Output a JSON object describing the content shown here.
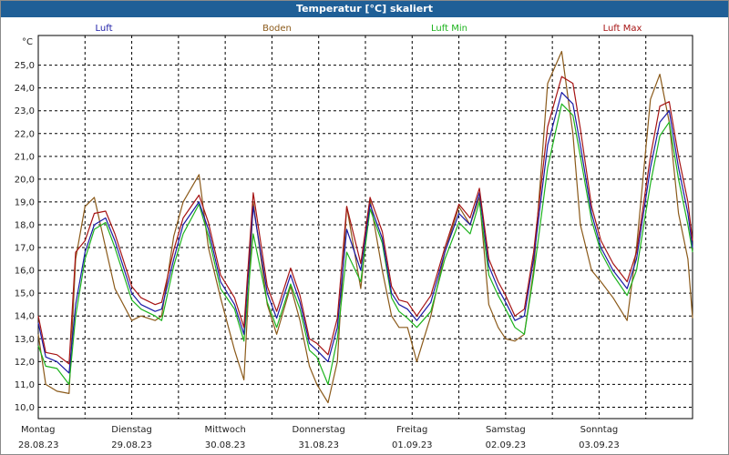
{
  "window": {
    "title": "Temperatur [°C] skaliert"
  },
  "chart_data": {
    "type": "line",
    "title": "Temperatur [°C] skaliert",
    "ylabel": "°C",
    "ylim": [
      9.5,
      26.3
    ],
    "yticks": [
      "10,0",
      "11,0",
      "12,0",
      "13,0",
      "14,0",
      "15,0",
      "16,0",
      "17,0",
      "18,0",
      "19,0",
      "20,0",
      "21,0",
      "22,0",
      "23,0",
      "24,0",
      "25,0"
    ],
    "xlim": [
      0,
      7.0
    ],
    "days": [
      {
        "weekday": "Montag",
        "date": "28.08.23"
      },
      {
        "weekday": "Dienstag",
        "date": "29.08.23"
      },
      {
        "weekday": "Mittwoch",
        "date": "30.08.23"
      },
      {
        "weekday": "Donnerstag",
        "date": "31.08.23"
      },
      {
        "weekday": "Freitag",
        "date": "01.09.23"
      },
      {
        "weekday": "Samstag",
        "date": "02.09.23"
      },
      {
        "weekday": "Sonntag",
        "date": "03.09.23"
      }
    ],
    "grid": true,
    "legend_position": "top",
    "series": [
      {
        "name": "Luft",
        "color": "#1a1aa6",
        "x": [
          0,
          0.08,
          0.2,
          0.33,
          0.4,
          0.5,
          0.6,
          0.72,
          0.82,
          1.0,
          1.1,
          1.25,
          1.32,
          1.45,
          1.55,
          1.72,
          1.82,
          1.95,
          2.1,
          2.2,
          2.3,
          2.45,
          2.55,
          2.7,
          2.8,
          2.9,
          2.98,
          3.1,
          3.2,
          3.3,
          3.45,
          3.55,
          3.68,
          3.78,
          3.86,
          3.95,
          4.05,
          4.2,
          4.35,
          4.5,
          4.62,
          4.72,
          4.82,
          4.92,
          5.0,
          5.1,
          5.2,
          5.3,
          5.45,
          5.6,
          5.72,
          5.8,
          5.92,
          6.02,
          6.15,
          6.3,
          6.4,
          6.55,
          6.65,
          6.75,
          6.85,
          6.95,
          7.0
        ],
        "y": [
          13.7,
          12.2,
          12.0,
          11.5,
          14.5,
          16.8,
          18.0,
          18.3,
          17.3,
          15.0,
          14.5,
          14.2,
          14.3,
          16.5,
          18.0,
          19.0,
          17.8,
          15.5,
          14.5,
          13.2,
          18.8,
          15.0,
          13.9,
          15.8,
          14.6,
          12.8,
          12.5,
          12.0,
          13.5,
          17.8,
          16.0,
          18.9,
          17.4,
          15.0,
          14.5,
          14.3,
          13.8,
          14.6,
          16.8,
          18.5,
          18.0,
          19.4,
          16.2,
          15.2,
          14.6,
          13.8,
          14.0,
          16.5,
          21.5,
          23.8,
          23.3,
          21.5,
          18.5,
          17.0,
          16.0,
          15.2,
          16.5,
          20.5,
          22.5,
          23.0,
          20.5,
          18.5,
          17.0
        ]
      },
      {
        "name": "Boden",
        "color": "#8b5a1a",
        "x": [
          0,
          0.08,
          0.2,
          0.33,
          0.4,
          0.5,
          0.6,
          0.72,
          0.82,
          1.0,
          1.1,
          1.25,
          1.32,
          1.45,
          1.55,
          1.72,
          1.82,
          1.95,
          2.1,
          2.2,
          2.3,
          2.45,
          2.55,
          2.7,
          2.8,
          2.9,
          2.98,
          3.1,
          3.2,
          3.3,
          3.45,
          3.55,
          3.68,
          3.78,
          3.86,
          3.95,
          4.05,
          4.2,
          4.35,
          4.5,
          4.62,
          4.72,
          4.82,
          4.92,
          5.0,
          5.1,
          5.2,
          5.3,
          5.45,
          5.6,
          5.72,
          5.8,
          5.92,
          6.02,
          6.15,
          6.3,
          6.4,
          6.55,
          6.65,
          6.75,
          6.85,
          6.95,
          7.0
        ],
        "y": [
          13.2,
          11.0,
          10.7,
          10.6,
          16.5,
          18.8,
          19.2,
          17.0,
          15.2,
          13.8,
          14.0,
          13.8,
          14.0,
          17.5,
          19.0,
          20.2,
          17.0,
          14.8,
          12.5,
          11.2,
          19.0,
          14.5,
          13.2,
          15.3,
          13.8,
          11.8,
          11.0,
          10.2,
          12.0,
          18.8,
          15.2,
          19.1,
          16.0,
          14.0,
          13.5,
          13.5,
          12.0,
          14.0,
          16.8,
          18.8,
          18.0,
          19.2,
          14.5,
          13.5,
          13.0,
          12.9,
          13.2,
          16.0,
          24.2,
          25.6,
          22.0,
          18.0,
          16.0,
          15.5,
          14.8,
          13.8,
          17.0,
          23.5,
          24.6,
          22.5,
          18.5,
          16.5,
          13.9
        ]
      },
      {
        "name": "Luft Min",
        "color": "#1db31d",
        "x": [
          0,
          0.08,
          0.2,
          0.33,
          0.4,
          0.5,
          0.6,
          0.72,
          0.82,
          1.0,
          1.1,
          1.25,
          1.32,
          1.45,
          1.55,
          1.72,
          1.82,
          1.95,
          2.1,
          2.2,
          2.3,
          2.45,
          2.55,
          2.7,
          2.8,
          2.9,
          2.98,
          3.1,
          3.2,
          3.3,
          3.45,
          3.55,
          3.68,
          3.78,
          3.86,
          3.95,
          4.05,
          4.2,
          4.35,
          4.5,
          4.62,
          4.72,
          4.82,
          4.92,
          5.0,
          5.1,
          5.2,
          5.3,
          5.45,
          5.6,
          5.72,
          5.8,
          5.92,
          6.02,
          6.15,
          6.3,
          6.4,
          6.55,
          6.65,
          6.75,
          6.85,
          6.95,
          7.0
        ],
        "y": [
          12.7,
          11.8,
          11.7,
          11.0,
          14.0,
          16.5,
          17.8,
          18.1,
          17.0,
          14.7,
          14.3,
          14.0,
          13.8,
          16.2,
          17.6,
          18.9,
          17.5,
          15.2,
          14.3,
          12.9,
          17.6,
          14.6,
          13.5,
          15.4,
          14.3,
          12.5,
          12.2,
          11.0,
          13.0,
          16.8,
          15.5,
          18.7,
          17.2,
          14.8,
          14.2,
          13.9,
          13.5,
          14.2,
          16.5,
          18.1,
          17.6,
          19.0,
          15.8,
          14.9,
          14.3,
          13.5,
          13.2,
          15.8,
          20.5,
          23.3,
          22.8,
          21.0,
          18.2,
          16.8,
          15.8,
          14.9,
          16.0,
          19.8,
          21.9,
          22.5,
          20.0,
          18.0,
          16.8
        ]
      },
      {
        "name": "Luft Max",
        "color": "#a61414",
        "x": [
          0,
          0.08,
          0.2,
          0.33,
          0.4,
          0.5,
          0.6,
          0.72,
          0.82,
          1.0,
          1.1,
          1.25,
          1.32,
          1.45,
          1.55,
          1.72,
          1.82,
          1.95,
          2.1,
          2.2,
          2.3,
          2.45,
          2.55,
          2.7,
          2.8,
          2.9,
          2.98,
          3.1,
          3.2,
          3.3,
          3.45,
          3.55,
          3.68,
          3.78,
          3.86,
          3.95,
          4.05,
          4.2,
          4.35,
          4.5,
          4.62,
          4.72,
          4.82,
          4.92,
          5.0,
          5.1,
          5.2,
          5.3,
          5.45,
          5.6,
          5.72,
          5.8,
          5.92,
          6.02,
          6.15,
          6.3,
          6.4,
          6.55,
          6.65,
          6.75,
          6.85,
          6.95,
          7.0
        ],
        "y": [
          14.0,
          12.4,
          12.3,
          11.9,
          16.8,
          17.3,
          18.5,
          18.6,
          17.6,
          15.3,
          14.8,
          14.5,
          14.6,
          16.9,
          18.3,
          19.3,
          18.1,
          15.8,
          14.8,
          13.5,
          19.4,
          15.3,
          14.2,
          16.1,
          14.9,
          13.0,
          12.8,
          12.3,
          13.9,
          18.8,
          16.3,
          19.2,
          17.7,
          15.3,
          14.7,
          14.6,
          14.0,
          14.9,
          17.0,
          18.9,
          18.3,
          19.6,
          16.5,
          15.5,
          14.9,
          14.0,
          14.3,
          16.8,
          22.3,
          24.5,
          24.2,
          22.2,
          18.8,
          17.3,
          16.3,
          15.5,
          16.8,
          21.0,
          23.2,
          23.4,
          21.0,
          19.0,
          17.3
        ]
      }
    ]
  }
}
